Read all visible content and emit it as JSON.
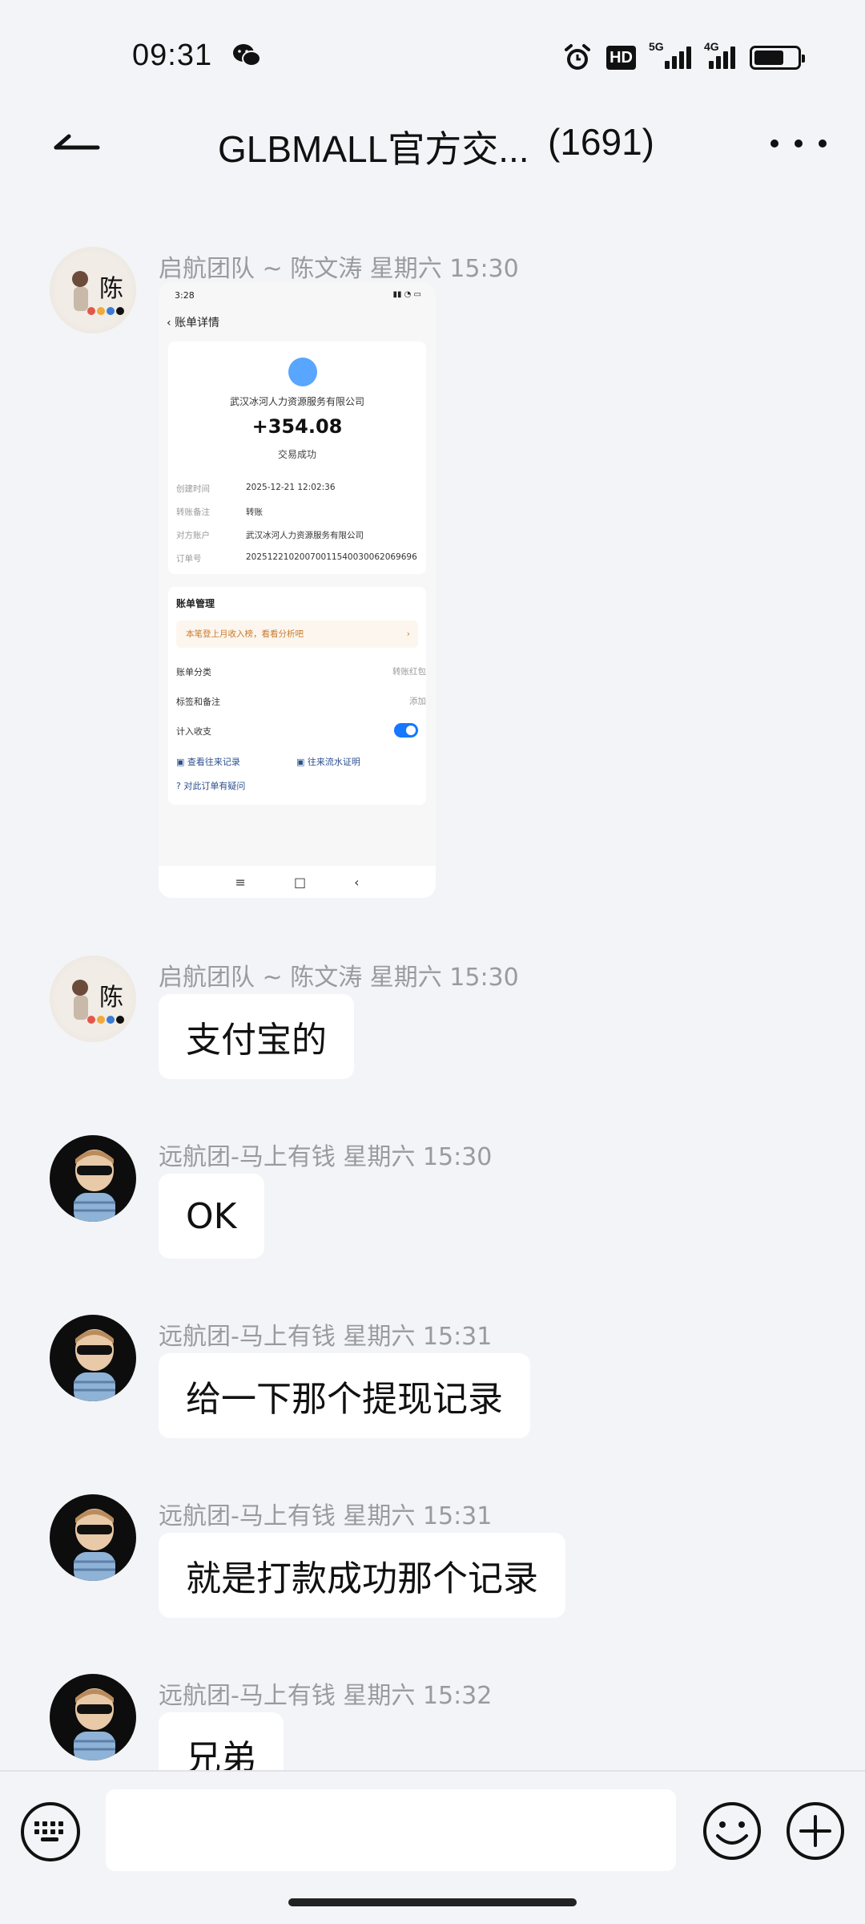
{
  "status_bar": {
    "time": "09:31",
    "hd_label": "HD",
    "net_5g": "5G",
    "net_4g": "4G"
  },
  "header": {
    "title": "GLBMALL官方交...",
    "member_count": "(1691)"
  },
  "messages": [
    {
      "sender": "启航团队 ~ 陈文涛 星期六 15:30",
      "type": "image",
      "screenshot": {
        "status_time": "3:28",
        "header": "账单详情",
        "company": "武汉冰河人力资源服务有限公司",
        "amount": "+354.08",
        "result": "交易成功",
        "rows": [
          {
            "label": "创建时间",
            "value": "2025-12-21 12:02:36"
          },
          {
            "label": "转账备注",
            "value": "转账"
          },
          {
            "label": "对方账户",
            "value": "武汉冰河人力资源服务有限公司"
          },
          {
            "label": "订单号",
            "value": "2025122102007001154003006206969​6"
          }
        ],
        "section_title": "账单管理",
        "tip": "本笔登上月收入榜，看看分析吧",
        "category_label": "账单分类",
        "category_value": "转账红包",
        "tag_label": "标签和备注",
        "tag_value": "添加",
        "count_label": "计入收支",
        "link1": "查看往来记录",
        "link2": "往来流水证明",
        "link3": "对此订单有疑问"
      }
    },
    {
      "sender": "启航团队 ~ 陈文涛 星期六 15:30",
      "type": "text",
      "text": "支付宝的"
    },
    {
      "sender": "远航团-马上有钱 星期六 15:30",
      "type": "text",
      "text": "OK"
    },
    {
      "sender": "远航团-马上有钱 星期六 15:31",
      "type": "text",
      "text": "给一下那个提现记录"
    },
    {
      "sender": "远航团-马上有钱 星期六 15:31",
      "type": "text",
      "text": "就是打款成功那个记录"
    },
    {
      "sender": "远航团-马上有钱 星期六 15:32",
      "type": "text",
      "text": "兄弟"
    }
  ],
  "input": {
    "placeholder": ""
  },
  "icons": {
    "back": "back-arrow-icon",
    "more": "more-icon",
    "keyboard": "keyboard-icon",
    "emoji": "emoji-icon",
    "plus": "plus-icon"
  }
}
